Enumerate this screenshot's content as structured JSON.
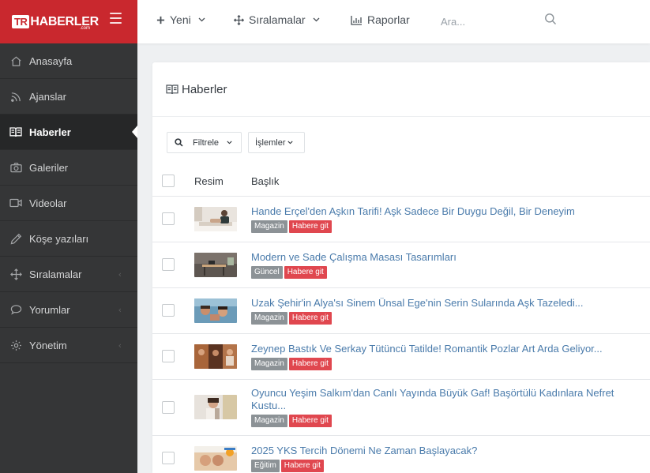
{
  "brand": {
    "tr": "TR",
    "name": "HABERLER",
    "suffix": ".com"
  },
  "sidebar": {
    "items": [
      {
        "label": "Anasayfa",
        "icon": "home-icon"
      },
      {
        "label": "Ajanslar",
        "icon": "rss-icon"
      },
      {
        "label": "Haberler",
        "icon": "newspaper-icon",
        "active": true
      },
      {
        "label": "Galeriler",
        "icon": "camera-icon"
      },
      {
        "label": "Videolar",
        "icon": "video-icon"
      },
      {
        "label": "Köşe yazıları",
        "icon": "pencil-icon"
      },
      {
        "label": "Sıralamalar",
        "icon": "move-icon",
        "has_children": true
      },
      {
        "label": "Yorumlar",
        "icon": "comment-icon",
        "has_children": true
      },
      {
        "label": "Yönetim",
        "icon": "gear-icon",
        "has_children": true
      }
    ]
  },
  "topbar": {
    "new_label": "Yeni",
    "rankings_label": "Sıralamalar",
    "reports_label": "Raporlar",
    "search_placeholder": "Ara..."
  },
  "panel": {
    "title": "Haberler",
    "filter_label": "Filtrele",
    "actions_label": "İşlemler",
    "columns": {
      "image": "Resim",
      "title": "Başlık"
    },
    "go_label": "Habere git"
  },
  "rows": [
    {
      "title": "Hande Erçel'den Aşkın Tarifi! Aşk Sadece Bir Duygu Değil, Bir Deneyim",
      "category": "Magazin"
    },
    {
      "title": "Modern ve Sade Çalışma Masası Tasarımları",
      "category": "Güncel"
    },
    {
      "title": "Uzak Şehir'in Alya'sı Sinem Ünsal Ege'nin Serin Sularında Aşk Tazeledi...",
      "category": "Magazin"
    },
    {
      "title": "Zeynep Bastık Ve Serkay Tütüncü Tatilde! Romantik Pozlar Art Arda Geliyor...",
      "category": "Magazin"
    },
    {
      "title": "Oyuncu Yeşim Salkım'dan Canlı Yayında Büyük Gaf! Başörtülü Kadınlara Nefret Kustu...",
      "category": "Magazin"
    },
    {
      "title": "2025 YKS Tercih Dönemi Ne Zaman Başlayacak?",
      "category": "Eğitim"
    }
  ],
  "colors": {
    "brand_red": "#c9282e",
    "sidebar_bg": "#353637",
    "link_blue": "#4a7bab",
    "badge_gray": "#8c9296",
    "badge_red": "#e0474f"
  }
}
